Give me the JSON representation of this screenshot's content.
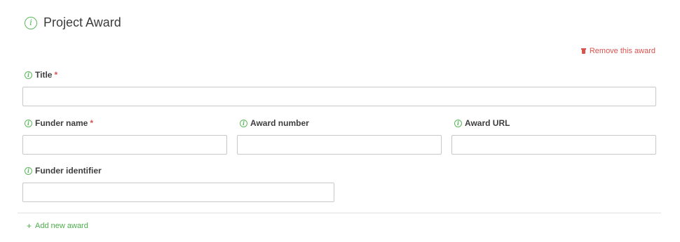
{
  "section": {
    "title": "Project Award",
    "info_icon": "info-circle-icon"
  },
  "remove_award": {
    "label": "Remove this award",
    "icon": "trash-icon"
  },
  "fields": {
    "title": {
      "label": "Title",
      "required_mark": "*",
      "value": "",
      "placeholder": ""
    },
    "funder_name": {
      "label": "Funder name",
      "required_mark": "*",
      "value": "",
      "placeholder": ""
    },
    "award_number": {
      "label": "Award number",
      "value": "",
      "placeholder": ""
    },
    "award_url": {
      "label": "Award URL",
      "value": "",
      "placeholder": ""
    },
    "funder_identifier": {
      "label": "Funder identifier",
      "value": "",
      "placeholder": ""
    }
  },
  "add_award": {
    "label": "Add new award",
    "icon": "plus-icon"
  },
  "colors": {
    "accent_green": "#5cb85c",
    "danger_red": "#d9534f",
    "input_border": "#c8c8c8"
  }
}
